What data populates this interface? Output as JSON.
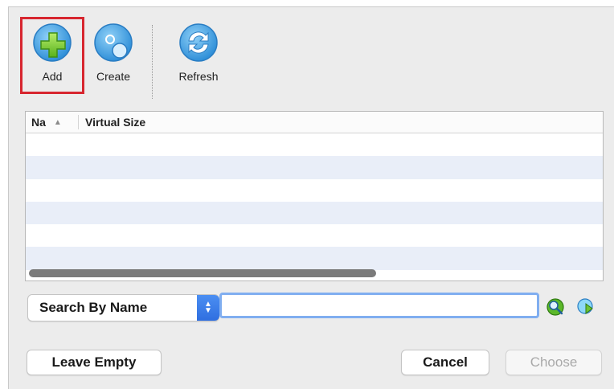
{
  "toolbar": {
    "add_label": "Add",
    "create_label": "Create",
    "refresh_label": "Refresh",
    "selected": "Add"
  },
  "table": {
    "columns": [
      "Na",
      "Virtual Size"
    ],
    "sort_indicator": "▲",
    "rows": []
  },
  "search": {
    "mode_label": "Search By Name",
    "value": "",
    "placeholder": ""
  },
  "buttons": {
    "leave_empty": "Leave Empty",
    "cancel": "Cancel",
    "choose": "Choose"
  },
  "colors": {
    "selection_outline": "#d7262f",
    "accent": "#2f6fe0",
    "row_alt": "#e9eef8"
  },
  "icons": {
    "add": "add-disk-icon",
    "create": "create-disk-icon",
    "refresh": "refresh-icon",
    "find": "find-icon",
    "find_next": "find-next-icon"
  }
}
